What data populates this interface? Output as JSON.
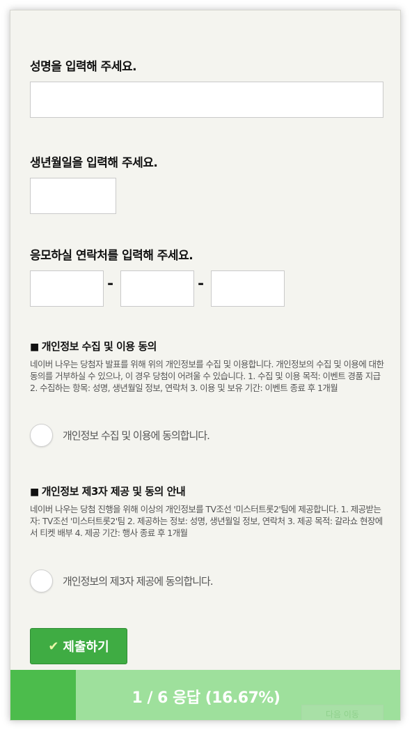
{
  "form": {
    "name_question": "성명을 입력해 주세요.",
    "name_value": "",
    "birth_question": "생년월일을 입력해 주세요.",
    "birth_value": "",
    "contact_question": "응모하실 연락처를 입력해 주세요.",
    "contact_separator": "-",
    "contact_values": [
      "",
      "",
      ""
    ]
  },
  "privacy": {
    "title_marker": "■",
    "title": "개인정보 수집 및 이용 동의",
    "body": "네이버 나우는 당첨자 발표를 위해 위의 개인정보를 수집 및 이용합니다. 개인정보의 수집 및 이용에 대한 동의를 거부하실 수 있으나, 이 경우 당첨이 어려울 수 있습니다. 1. 수집 및 이용 목적: 이벤트 경품 지급 2. 수집하는 항목: 성명, 생년월일 정보, 연락처 3. 이용 및 보유 기간: 이벤트 종료 후 1개월",
    "consent_label": "개인정보 수집 및 이용에 동의합니다."
  },
  "third_party": {
    "title_marker": "■",
    "title": "개인정보 제3자 제공 및 동의 안내",
    "body": "네이버 나우는 당첨 진행을 위해 이상의 개인정보를 TV조선 '미스터트롯2'팀에 제공합니다. 1. 제공받는자: TV조선 '미스터트롯2'팀 2. 제공하는 정보: 성명, 생년월일 정보, 연락처 3. 제공 목적: 갈라쇼 현장에서 티켓 배부 4. 제공 기간: 행사 종료 후 1개월",
    "consent_label": "개인정보의 제3자 제공에 동의합니다."
  },
  "submit": {
    "check_icon": "✔",
    "label": "제출하기"
  },
  "progress": {
    "fraction": 0.1667,
    "label": "1 / 6 응답 (16.67%)"
  },
  "hidden_button": {
    "label": "다음 이동"
  },
  "colors": {
    "accent": "#3fac43",
    "progress_fill": "#4cbc4c",
    "progress_track": "#9ee09c"
  }
}
